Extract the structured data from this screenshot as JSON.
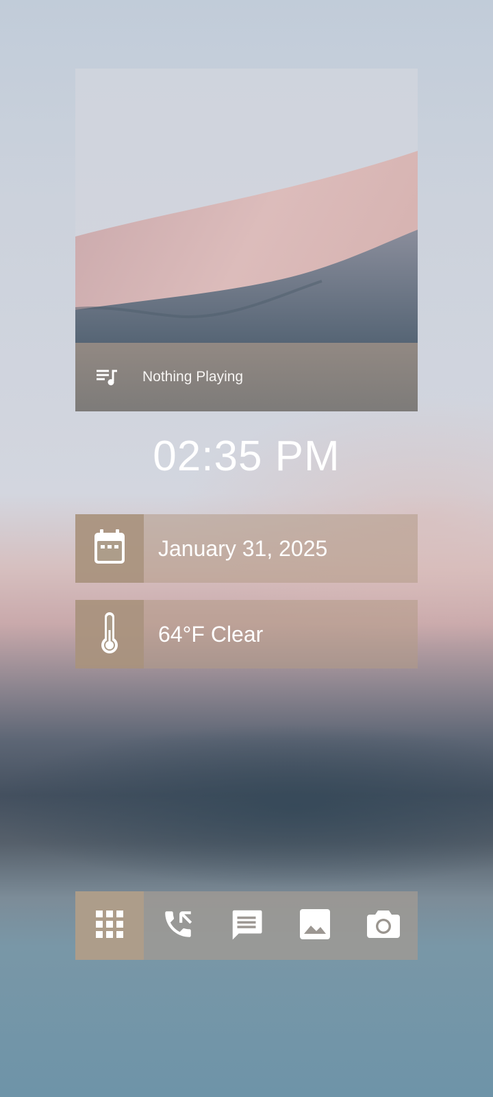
{
  "media": {
    "status": "Nothing Playing",
    "icon": "playlist-music-icon"
  },
  "clock": {
    "time": "02:35 PM"
  },
  "date_widget": {
    "icon": "calendar-icon",
    "text": "January 31, 2025"
  },
  "weather_widget": {
    "icon": "thermometer-icon",
    "text": "64°F Clear"
  },
  "dock": {
    "items": [
      {
        "icon": "apps-grid-icon"
      },
      {
        "icon": "phone-icon"
      },
      {
        "icon": "message-icon"
      },
      {
        "icon": "gallery-icon"
      },
      {
        "icon": "camera-icon"
      }
    ]
  },
  "colors": {
    "accent": "#ad9d8a",
    "text": "#ffffff"
  }
}
